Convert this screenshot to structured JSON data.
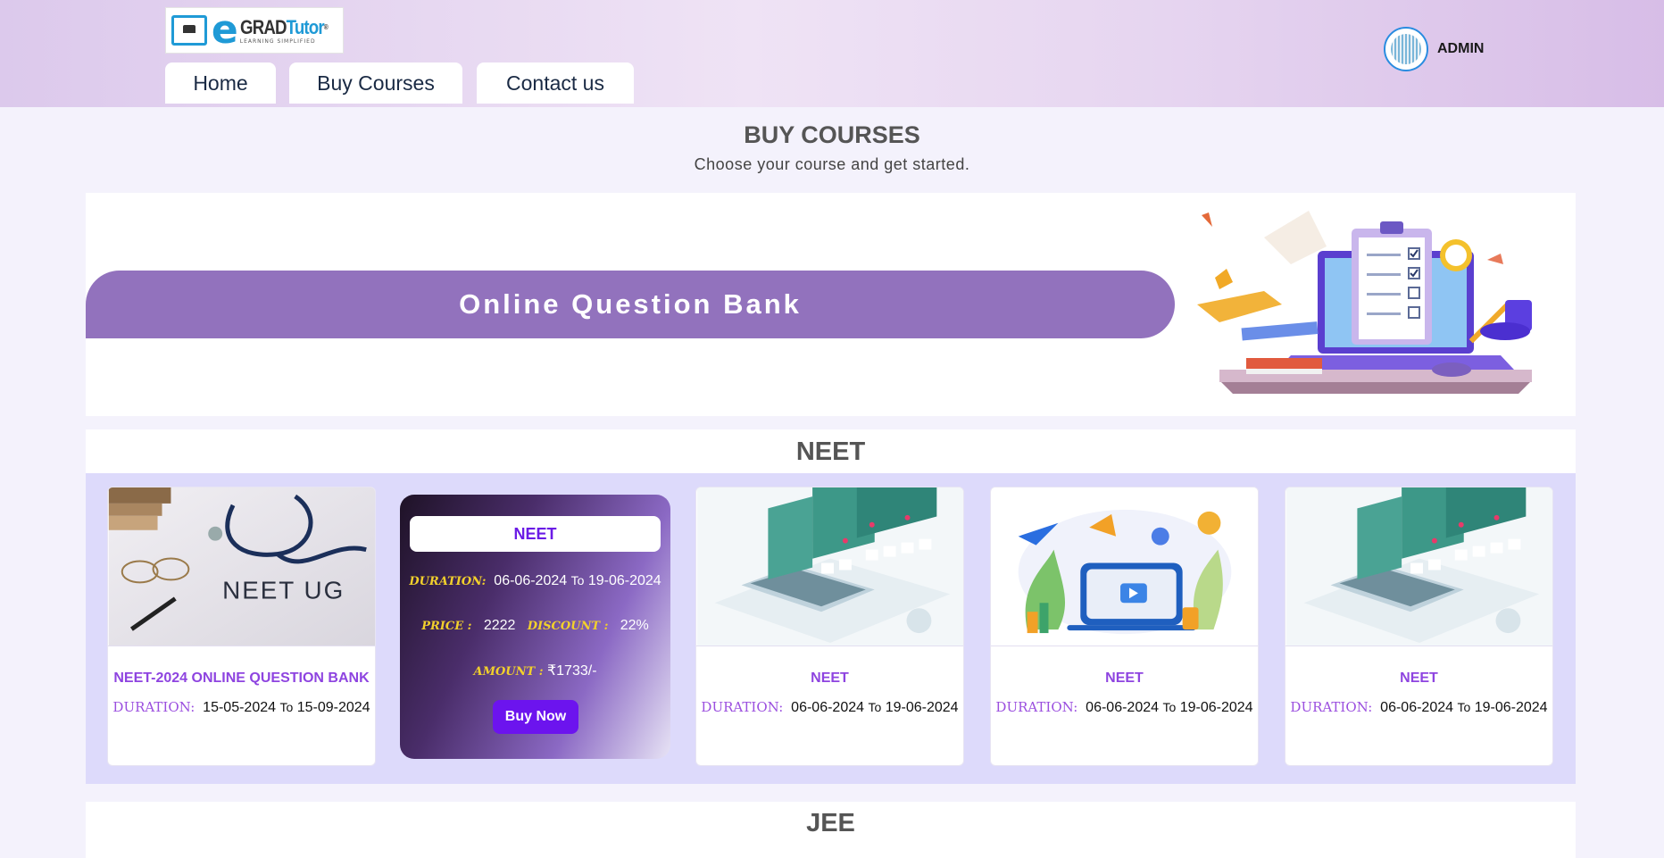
{
  "header": {
    "logo": {
      "letter": "e",
      "name_a": "GRAD",
      "name_b": "Tutor",
      "mark": "®",
      "tagline": "LEARNING SIMPLIFIED"
    },
    "nav": [
      {
        "label": "Home"
      },
      {
        "label": "Buy Courses"
      },
      {
        "label": "Contact us"
      }
    ],
    "user": {
      "name": "ADMIN",
      "icon": "avatar-icon"
    }
  },
  "page": {
    "title": "BUY COURSES",
    "subtitle": "Choose your course and get started."
  },
  "banner": {
    "heading": "Online Question Bank",
    "illustration": "laptop-checklist-illustration"
  },
  "sections": [
    {
      "name": "NEET",
      "courses": [
        {
          "title": "NEET-2024 ONLINE QUESTION BANK",
          "duration_label": "DURATION:",
          "start": "15-05-2024",
          "to": "To",
          "end": "15-09-2024",
          "image": "neet-ug-stethoscope"
        },
        {
          "title": "NEET",
          "duration_label": "DURATION:",
          "start": "06-06-2024",
          "to": "To",
          "end": "19-06-2024",
          "price_label": "PRICE :",
          "price": "2222",
          "discount_label": "DISCOUNT :",
          "discount": "22%",
          "amount_label": "AMOUNT :",
          "amount": "₹1733/-",
          "buy_label": "Buy Now"
        },
        {
          "title": "NEET",
          "duration_label": "DURATION:",
          "start": "06-06-2024",
          "to": "To",
          "end": "19-06-2024",
          "image": "laptop-tests-isometric"
        },
        {
          "title": "NEET",
          "duration_label": "DURATION:",
          "start": "06-06-2024",
          "to": "To",
          "end": "19-06-2024",
          "image": "laptop-video-plants"
        },
        {
          "title": "NEET",
          "duration_label": "DURATION:",
          "start": "06-06-2024",
          "to": "To",
          "end": "19-06-2024",
          "image": "laptop-tests-isometric"
        }
      ],
      "neet_ug_caption": "NEET UG"
    },
    {
      "name": "JEE"
    }
  ],
  "colors": {
    "accent": "#9272bd",
    "brand_blue": "#1f9ad6",
    "buy_button": "#6c14ee",
    "course_title": "#8e44e0"
  }
}
